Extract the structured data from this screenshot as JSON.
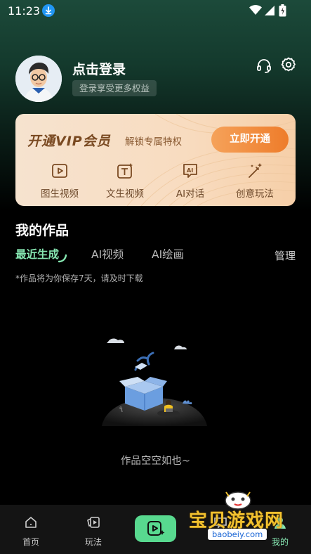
{
  "status_bar": {
    "time": "11:23"
  },
  "profile": {
    "title": "点击登录",
    "subtitle": "登录享受更多权益"
  },
  "vip": {
    "logo": "开通VIP会员",
    "description": "解锁专属特权",
    "button": "立即开通",
    "features": [
      {
        "label": "图生视频",
        "icon": "image-to-video-icon"
      },
      {
        "label": "文生视频",
        "icon": "text-to-video-icon"
      },
      {
        "label": "AI对话",
        "icon": "ai-chat-icon"
      },
      {
        "label": "创意玩法",
        "icon": "magic-wand-icon"
      }
    ]
  },
  "works": {
    "title": "我的作品",
    "tabs": [
      "最近生成",
      "AI视频",
      "AI绘画"
    ],
    "active_tab": "最近生成",
    "manage": "管理",
    "notice": "*作品将为你保存7天，请及时下载",
    "empty": "作品空空如也~"
  },
  "bottom_nav": [
    {
      "label": "首页",
      "icon": "home-icon"
    },
    {
      "label": "玩法",
      "icon": "play-cards-icon"
    },
    {
      "label": "",
      "icon": "create-video-icon"
    },
    {
      "label": "",
      "icon": "chat-icon"
    },
    {
      "label": "我的",
      "icon": "profile-icon"
    }
  ],
  "watermark": {
    "text": "宝贝游戏网",
    "url": "baobeiy.com"
  },
  "colors": {
    "accent": "#58d98f",
    "tab_active": "#86e6b1",
    "vip_button": "#ee7c2a",
    "vip_card": "#f8dcc0"
  }
}
